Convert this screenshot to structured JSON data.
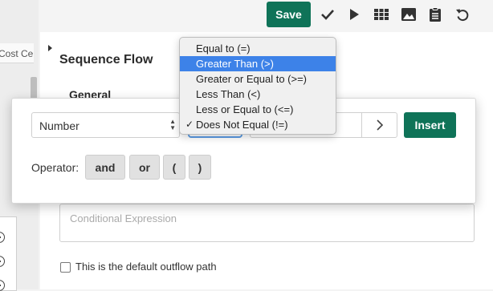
{
  "sidebar": {
    "tab_label": "Cost Ce"
  },
  "toolbar": {
    "save_label": "Save",
    "icons": [
      "check-icon",
      "play-icon",
      "grid-icon",
      "image-icon",
      "clipboard-icon",
      "undo-icon"
    ]
  },
  "panel": {
    "title": "Sequence Flow",
    "section": "General",
    "expression_placeholder": "Conditional Expression",
    "default_outflow_label": "This is the default outflow path"
  },
  "builder": {
    "field_value": "Number",
    "insert_label": "Insert",
    "operator_label": "Operator:",
    "operator_buttons": [
      "and",
      "or",
      "(",
      ")"
    ]
  },
  "dropdown": {
    "items": [
      {
        "label": "Equal to (=)"
      },
      {
        "label": "Greater Than (>)"
      },
      {
        "label": "Greater or Equal to (>=)"
      },
      {
        "label": "Less Than (<)"
      },
      {
        "label": "Less or Equal to (<=)"
      },
      {
        "label": "Does Not Equal (!=)"
      }
    ],
    "highlighted_index": 1,
    "checked_index": 5,
    "check_mark": "✓"
  },
  "colors": {
    "accent_green": "#0f7358",
    "highlight_blue": "#3d82e8"
  }
}
